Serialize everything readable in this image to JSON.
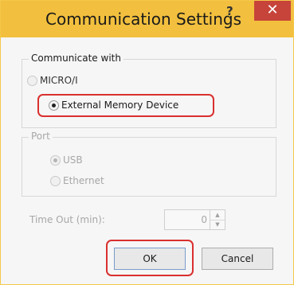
{
  "dialog": {
    "title": "Communication Settings",
    "help_label": "?",
    "close_label": "✕"
  },
  "communicate": {
    "label": "Communicate with",
    "options": [
      {
        "label": "MICRO/I",
        "selected": false
      },
      {
        "label": "External Memory Device",
        "selected": true
      }
    ]
  },
  "port": {
    "label": "Port",
    "options": [
      {
        "label": "USB",
        "selected": true
      },
      {
        "label": "Ethernet",
        "selected": false
      }
    ]
  },
  "timeout": {
    "label": "Time Out (min):",
    "value": "0"
  },
  "buttons": {
    "ok_label": "OK",
    "cancel_label": "Cancel"
  },
  "colors": {
    "titlebar": "#f2c03e",
    "close": "#c7443a",
    "highlight": "#d9302f"
  }
}
